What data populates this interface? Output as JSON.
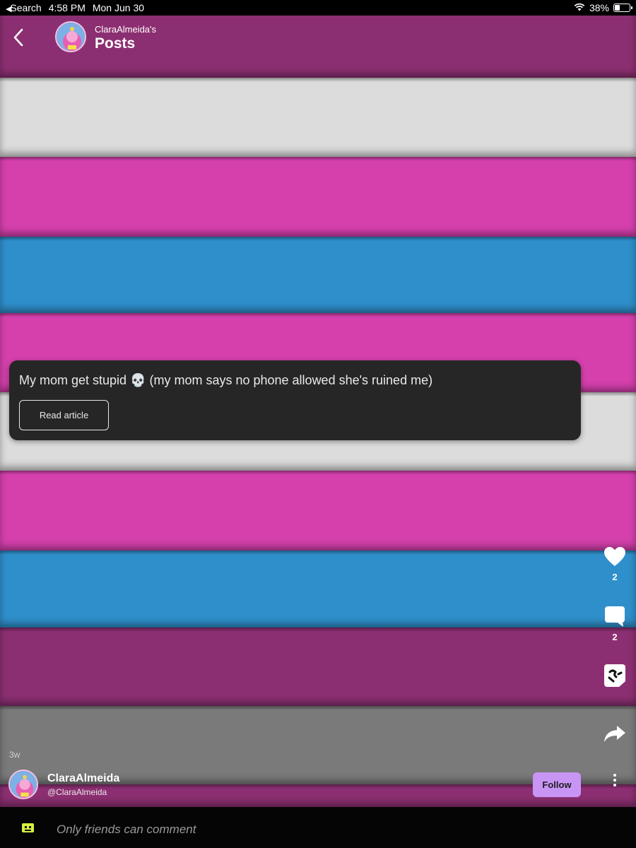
{
  "status_bar": {
    "back_app": "Search",
    "time": "4:58 PM",
    "date": "Mon Jun 30",
    "battery": "38%",
    "battery_level": 0.38
  },
  "header": {
    "owner": "ClaraAlmeida's",
    "title": "Posts"
  },
  "background": {
    "stripe_colors": [
      "#8c2f72",
      "#dcdcdc",
      "#d640ad",
      "#2f8fcb",
      "#d640ad",
      "#dcdcdc",
      "#d640ad",
      "#2f8fcb",
      "#8c2f72",
      "#7a7a7a",
      "#8c2f72"
    ]
  },
  "post": {
    "text": "My mom get stupid 💀  (my mom says no phone allowed she's ruined me)",
    "read_article_label": "Read article",
    "time_ago": "3w"
  },
  "actions": {
    "like_count": "2",
    "comment_count": "2"
  },
  "author": {
    "name": "ClaraAlmeida",
    "handle": "@ClaraAlmeida",
    "follow_label": "Follow"
  },
  "comment_bar": {
    "placeholder": "Only friends can comment"
  },
  "colors": {
    "accent": "#c895f5",
    "card_bg": "#262626"
  }
}
